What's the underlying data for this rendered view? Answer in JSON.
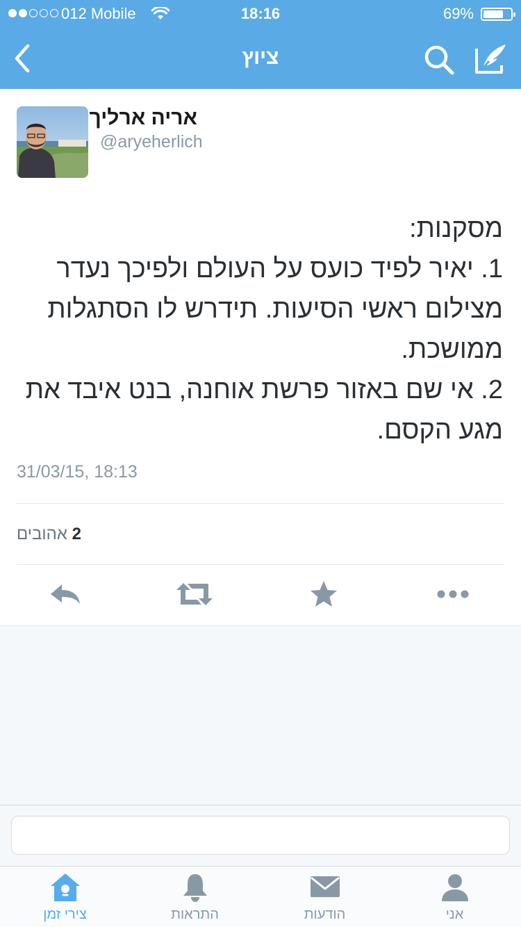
{
  "status_bar": {
    "carrier": "012 Mobile",
    "time": "18:16",
    "battery_percent": "69%",
    "battery_level": 0.69,
    "signal_bars": 2
  },
  "nav": {
    "title": "ציוץ",
    "icons": [
      "chevron-left-icon",
      "search-icon",
      "compose-icon"
    ]
  },
  "tweet": {
    "author_name": "אריה ארליך",
    "author_handle": "@aryeherlich",
    "lines": [
      "מסקנות:",
      "1. יאיר לפיד כועס על העולם ולפיכך נעדר",
      "מצילום ראשי הסיעות. תידרש לו הסתגלות",
      "ממושכת.",
      "2. אי שם באזור פרשת אוחנה, בנט איבד את",
      "מגע הקסם."
    ],
    "timestamp": "31/03/15, 18:13",
    "likes_count": "2",
    "likes_label": "אהובים"
  },
  "actions": [
    "reply-icon",
    "retweet-icon",
    "favorite-icon",
    "more-icon"
  ],
  "reply": {
    "placeholder": ""
  },
  "tabs": [
    {
      "label": "צירי זמן",
      "icon": "home-icon",
      "active": true
    },
    {
      "label": "התראות",
      "icon": "bell-icon",
      "active": false
    },
    {
      "label": "הודעות",
      "icon": "envelope-icon",
      "active": false
    },
    {
      "label": "אני",
      "icon": "person-icon",
      "active": false
    }
  ],
  "colors": {
    "accent": "#5aaae6",
    "tab_active": "#55acee",
    "icon_gray": "#8899a6",
    "text": "#292f33"
  }
}
